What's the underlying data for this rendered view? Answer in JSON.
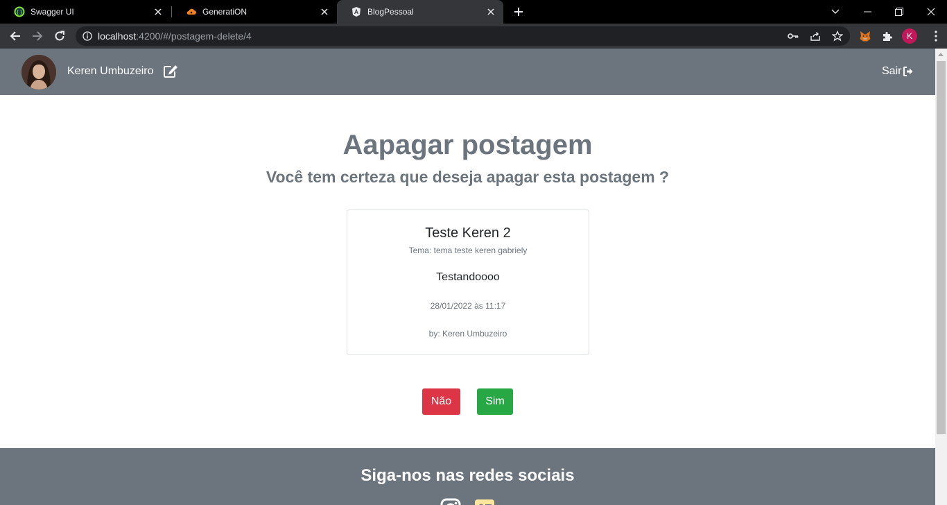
{
  "browser": {
    "tabs": [
      {
        "title": "Swagger UI",
        "icon": "swagger-icon"
      },
      {
        "title": "GeneratiON",
        "icon": "cloud-icon"
      },
      {
        "title": "BlogPessoal",
        "icon": "angular-icon",
        "active": true
      }
    ],
    "url": {
      "host": "localhost",
      "path": ":4200/#/postagem-delete/4"
    },
    "profile_initial": "K"
  },
  "nav": {
    "user_name": "Keren Umbuzeiro",
    "logout_label": "Sair"
  },
  "main": {
    "title": "Aapagar postagem",
    "subtitle": "Você tem certeza que deseja apagar esta postagem ?"
  },
  "post": {
    "title": "Teste Keren 2",
    "tema": "Tema: tema teste keren gabriely",
    "text": "Testandoooo",
    "date": "28/01/2022 às 11:17",
    "author": "by: Keren Umbuzeiro"
  },
  "actions": {
    "no_label": "Não",
    "yes_label": "Sim"
  },
  "footer": {
    "title": "Siga-nos nas redes sociais"
  },
  "colors": {
    "nav_bg": "#6c757d",
    "danger": "#dc3545",
    "success": "#28a745"
  }
}
